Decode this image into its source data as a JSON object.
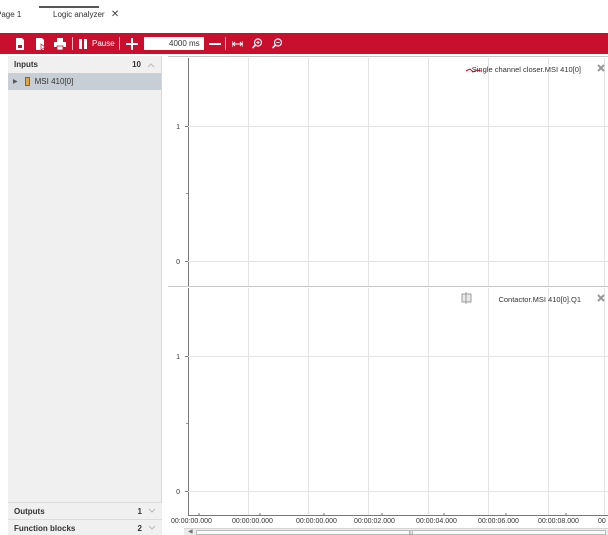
{
  "tabs": [
    {
      "label": "Page 1",
      "active": false
    },
    {
      "label": "Logic analyzer",
      "active": true,
      "close": "✕"
    }
  ],
  "toolbar": {
    "accent_color": "#c8102e",
    "icons": [
      "save-icon",
      "save-as-icon",
      "print-icon"
    ],
    "pause_label": "Pause",
    "time_value": "4000 ms",
    "extra_icons": [
      "fit-width-icon",
      "zoom-in-icon",
      "zoom-out-icon"
    ]
  },
  "sidebar": {
    "inputs": {
      "title": "Inputs",
      "count": "10"
    },
    "items": [
      {
        "label": "MSI 410[0]"
      }
    ],
    "outputs": {
      "title": "Outputs",
      "count": "1"
    },
    "function_blocks": {
      "title": "Function blocks",
      "count": "2"
    }
  },
  "chart_data": [
    {
      "type": "line",
      "legend": "Single channel closer.MSI 410[0]",
      "legend_icon": "signal-line-icon",
      "y_ticks": [
        "1",
        "0"
      ],
      "ylim": [
        0,
        1
      ],
      "grid": true,
      "series": []
    },
    {
      "type": "line",
      "legend": "Contactor.MSI 410[0].Q1",
      "legend_icon": "contactor-icon",
      "y_ticks": [
        "1",
        "0"
      ],
      "ylim": [
        0,
        1
      ],
      "grid": true,
      "series": []
    }
  ],
  "x_ticks": [
    "00:00:00.000",
    "00:00:00.000",
    "00:00:00.000",
    "00:00:02.000",
    "00:00:04.000",
    "00:00:06.000",
    "00:00:08.000",
    "00"
  ]
}
